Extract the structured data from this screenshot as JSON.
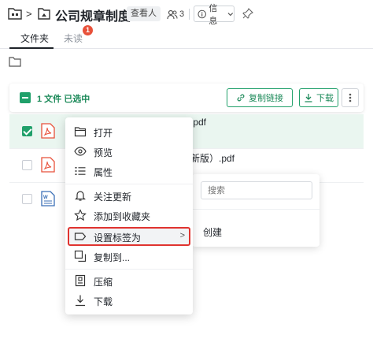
{
  "header": {
    "title": "公司规章制度",
    "role_badge": "查看人",
    "member_count": "3",
    "info_label": "信息"
  },
  "tabs": {
    "folder": "文件夹",
    "unread": "未读",
    "unread_count": "1"
  },
  "selection_bar": {
    "selected_text": "1 文件 已选中",
    "copy_link": "复制链接",
    "download": "下载"
  },
  "files": [
    {
      "name": ".pdf",
      "type": "pdf",
      "checked": true
    },
    {
      "name": "新版）.pdf",
      "type": "pdf",
      "checked": false
    },
    {
      "name": "",
      "type": "doc",
      "checked": false
    }
  ],
  "context_menu": {
    "items": [
      {
        "label": "打开",
        "icon": "folder-open-icon"
      },
      {
        "label": "预览",
        "icon": "eye-icon"
      },
      {
        "label": "属性",
        "icon": "list-icon"
      },
      {
        "label": "关注更新",
        "icon": "bell-icon"
      },
      {
        "label": "添加到收藏夹",
        "icon": "star-icon"
      },
      {
        "label": "设置标签为",
        "icon": "tag-icon"
      },
      {
        "label": "复制到...",
        "icon": "copy-icon"
      },
      {
        "label": "压缩",
        "icon": "archive-icon"
      },
      {
        "label": "下载",
        "icon": "download-icon"
      }
    ]
  },
  "submenu": {
    "search_placeholder": "搜索",
    "create_label": "创建"
  },
  "colors": {
    "accent": "#20a06a",
    "highlight_border": "#e0332f",
    "pdf_red": "#e8513a",
    "badge_red": "#e8513a"
  }
}
